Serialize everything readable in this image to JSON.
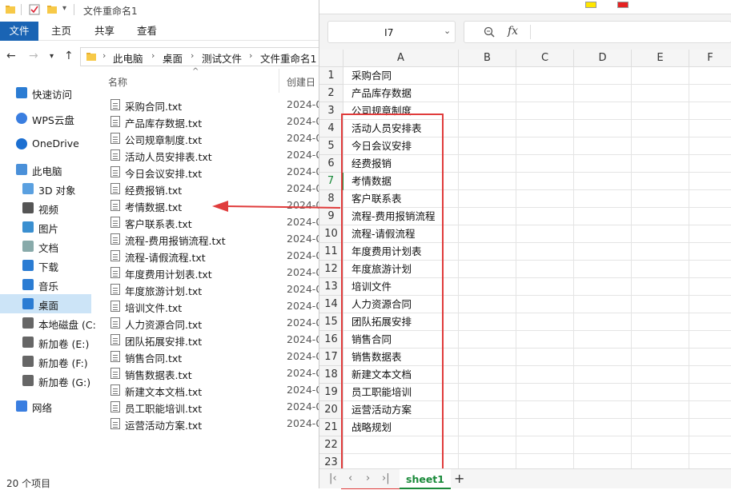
{
  "window": {
    "title": "文件重命名1"
  },
  "ribbon": {
    "tabs": [
      "文件",
      "主页",
      "共享",
      "查看"
    ]
  },
  "address": {
    "crumbs": [
      "此电脑",
      "桌面",
      "测试文件",
      "文件重命名1"
    ]
  },
  "nav": {
    "items": [
      {
        "label": "快速访问",
        "icon": "star-icon"
      },
      {
        "label": "WPS云盘",
        "icon": "cloud-icon"
      },
      {
        "label": "OneDrive",
        "icon": "onedrive-icon"
      },
      {
        "label": "此电脑",
        "icon": "computer-icon"
      },
      {
        "label": "3D 对象",
        "icon": "cube-icon"
      },
      {
        "label": "视频",
        "icon": "video-icon"
      },
      {
        "label": "图片",
        "icon": "picture-icon"
      },
      {
        "label": "文档",
        "icon": "document-icon"
      },
      {
        "label": "下载",
        "icon": "download-icon"
      },
      {
        "label": "音乐",
        "icon": "music-icon"
      },
      {
        "label": "桌面",
        "icon": "desktop-icon"
      },
      {
        "label": "本地磁盘 (C:",
        "icon": "drive-icon"
      },
      {
        "label": "新加卷 (E:)",
        "icon": "drive-icon"
      },
      {
        "label": "新加卷 (F:)",
        "icon": "drive-icon"
      },
      {
        "label": "新加卷 (G:)",
        "icon": "drive-icon"
      },
      {
        "label": "网络",
        "icon": "network-icon"
      }
    ]
  },
  "filelist": {
    "headers": {
      "name": "名称",
      "created": "创建日"
    },
    "files": [
      {
        "name": "采购合同.txt",
        "date": "2024-0"
      },
      {
        "name": "产品库存数据.txt",
        "date": "2024-0"
      },
      {
        "name": "公司规章制度.txt",
        "date": "2024-0"
      },
      {
        "name": "活动人员安排表.txt",
        "date": "2024-0"
      },
      {
        "name": "今日会议安排.txt",
        "date": "2024-0"
      },
      {
        "name": "经费报销.txt",
        "date": "2024-0"
      },
      {
        "name": "考情数据.txt",
        "date": "2024-0"
      },
      {
        "name": "客户联系表.txt",
        "date": "2024-0"
      },
      {
        "name": "流程-费用报销流程.txt",
        "date": "2024-0"
      },
      {
        "name": "流程-请假流程.txt",
        "date": "2024-0"
      },
      {
        "name": "年度费用计划表.txt",
        "date": "2024-0"
      },
      {
        "name": "年度旅游计划.txt",
        "date": "2024-0"
      },
      {
        "name": "培训文件.txt",
        "date": "2024-0"
      },
      {
        "name": "人力资源合同.txt",
        "date": "2024-0"
      },
      {
        "name": "团队拓展安排.txt",
        "date": "2024-0"
      },
      {
        "name": "销售合同.txt",
        "date": "2024-0"
      },
      {
        "name": "销售数据表.txt",
        "date": "2024-0"
      },
      {
        "name": "新建文本文档.txt",
        "date": "2024-0"
      },
      {
        "name": "员工职能培训.txt",
        "date": "2024-0"
      },
      {
        "name": "运营活动方案.txt",
        "date": "2024-0"
      }
    ]
  },
  "status": {
    "text": "20 个项目"
  },
  "spreadsheet": {
    "namebox": "I7",
    "fx_label": "fx",
    "columns": [
      "A",
      "B",
      "C",
      "D",
      "E",
      "F"
    ],
    "rows": [
      "1",
      "2",
      "3",
      "4",
      "5",
      "6",
      "7",
      "8",
      "9",
      "10",
      "11",
      "12",
      "13",
      "14",
      "15",
      "16",
      "17",
      "18",
      "19",
      "20",
      "21",
      "22",
      "23"
    ],
    "column_a": [
      "采购合同",
      "产品库存数据",
      "公司规章制度",
      "活动人员安排表",
      "今日会议安排",
      "经费报销",
      "考情数据",
      "客户联系表",
      "流程-费用报销流程",
      "流程-请假流程",
      "年度费用计划表",
      "年度旅游计划",
      "培训文件",
      "人力资源合同",
      "团队拓展安排",
      "销售合同",
      "销售数据表",
      "新建文本文档",
      "员工职能培训",
      "运营活动方案",
      "战略规划"
    ],
    "sheet_tab": "sheet1",
    "add_sheet": "+"
  },
  "colors": {
    "accent": "#1a64b4",
    "highlight_box": "#e03c3c",
    "sheet_tab": "#1a8a3a",
    "nav_selected": "#cce4f7"
  }
}
